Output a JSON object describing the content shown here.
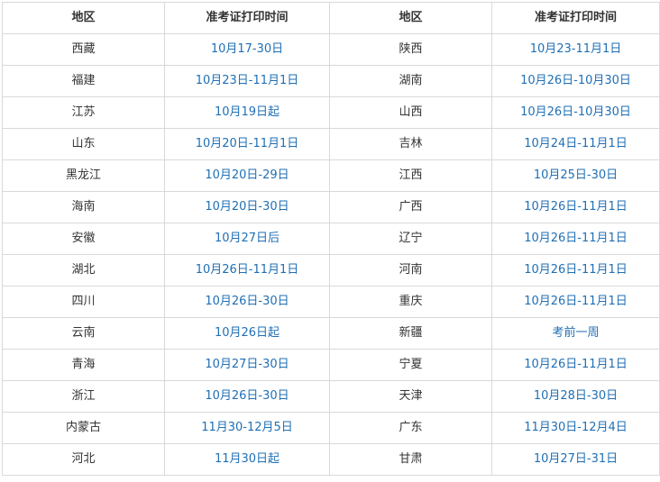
{
  "headers": [
    "地区",
    "准考证打印时间",
    "地区",
    "准考证打印时间"
  ],
  "rows": [
    [
      "西藏",
      "10月17-30日",
      "陕西",
      "10月23-11月1日"
    ],
    [
      "福建",
      "10月23日-11月1日",
      "湖南",
      "10月26日-10月30日"
    ],
    [
      "江苏",
      "10月19日起",
      "山西",
      "10月26日-10月30日"
    ],
    [
      "山东",
      "10月20日-11月1日",
      "吉林",
      "10月24日-11月1日"
    ],
    [
      "黑龙江",
      "10月20日-29日",
      "江西",
      "10月25日-30日"
    ],
    [
      "海南",
      "10月20日-30日",
      "广西",
      "10月26日-11月1日"
    ],
    [
      "安徽",
      "10月27日后",
      "辽宁",
      "10月26日-11月1日"
    ],
    [
      "湖北",
      "10月26日-11月1日",
      "河南",
      "10月26日-11月1日"
    ],
    [
      "四川",
      "10月26日-30日",
      "重庆",
      "10月26日-11月1日"
    ],
    [
      "云南",
      "10月26日起",
      "新疆",
      "考前一周"
    ],
    [
      "青海",
      "10月27日-30日",
      "宁夏",
      "10月26日-11月1日"
    ],
    [
      "浙江",
      "10月26日-30日",
      "天津",
      "10月28日-30日"
    ],
    [
      "内蒙古",
      "11月30-12月5日",
      "广东",
      "11月30日-12月4日"
    ],
    [
      "河北",
      "11月30日起",
      "甘肃",
      "10月27日-31日"
    ]
  ],
  "colors": {
    "region_text": "#333333",
    "time_text": "#1f6fb5",
    "border": "#d9d9d9"
  }
}
